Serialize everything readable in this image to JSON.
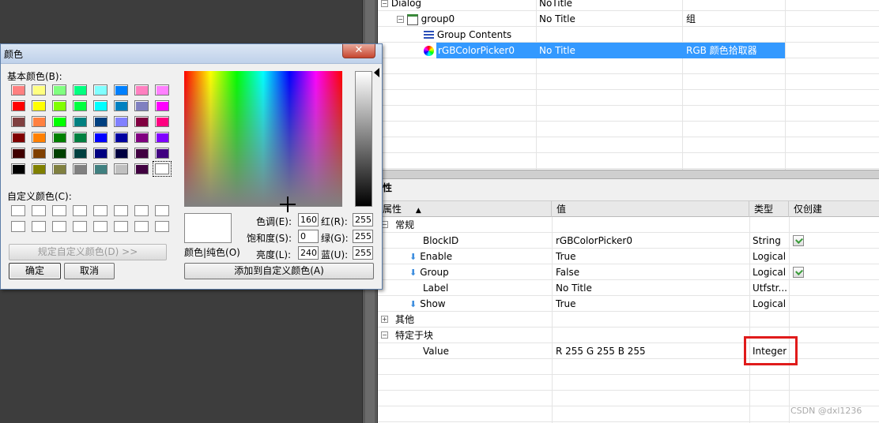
{
  "tree": {
    "rows": [
      {
        "name": "Dialog",
        "title": "NoTitle",
        "desc": ""
      },
      {
        "name": "group0",
        "title": "No Title",
        "desc": "组"
      },
      {
        "name": "Group Contents",
        "title": "",
        "desc": ""
      },
      {
        "name": "rGBColorPicker0",
        "title": "No Title",
        "desc": "RGB 颜色拾取器"
      }
    ]
  },
  "props": {
    "title": "性",
    "headers": {
      "name": "属性",
      "value": "值",
      "type": "类型",
      "readonly": "仅创建"
    },
    "rows": [
      {
        "kind": "group",
        "name": "常规"
      },
      {
        "kind": "prop",
        "name": "BlockID",
        "value": "rGBColorPicker0",
        "type": "String",
        "check": true,
        "arrow": false
      },
      {
        "kind": "prop",
        "name": "Enable",
        "value": "True",
        "type": "Logical",
        "check": false,
        "arrow": true
      },
      {
        "kind": "prop",
        "name": "Group",
        "value": "False",
        "type": "Logical",
        "check": true,
        "arrow": true
      },
      {
        "kind": "prop",
        "name": "Label",
        "value": "No Title",
        "type": "Utfstr...",
        "check": false,
        "arrow": false
      },
      {
        "kind": "prop",
        "name": "Show",
        "value": "True",
        "type": "Logical",
        "check": false,
        "arrow": true
      },
      {
        "kind": "group",
        "name": "其他",
        "collapsed": true
      },
      {
        "kind": "group",
        "name": "特定于块"
      },
      {
        "kind": "prop",
        "name": "Value",
        "value": "R 255 G 255 B 255",
        "type": "Integer",
        "check": false,
        "arrow": false
      }
    ]
  },
  "watermark": "CSDN @dxl1236",
  "dialog": {
    "title": "颜色",
    "close": "✕",
    "basic_label": "基本颜色(B):",
    "custom_label": "自定义颜色(C):",
    "define_custom": "规定自定义颜色(D) >>",
    "ok": "确定",
    "cancel": "取消",
    "color_solid": "颜色|纯色(O)",
    "hue_label": "色调(E):",
    "sat_label": "饱和度(S):",
    "lum_label": "亮度(L):",
    "red_label": "红(R):",
    "green_label": "绿(G):",
    "blue_label": "蓝(U):",
    "hue": "160",
    "sat": "0",
    "lum": "240",
    "red": "255",
    "green": "255",
    "blue": "255",
    "add_custom": "添加到自定义颜色(A)",
    "basic_colors": [
      "#ff8080",
      "#ffff80",
      "#80ff80",
      "#00ff80",
      "#80ffff",
      "#0080ff",
      "#ff80c0",
      "#ff80ff",
      "#ff0000",
      "#ffff00",
      "#80ff00",
      "#00ff40",
      "#00ffff",
      "#0080c0",
      "#8080c0",
      "#ff00ff",
      "#804040",
      "#ff8040",
      "#00ff00",
      "#008080",
      "#004080",
      "#8080ff",
      "#800040",
      "#ff0080",
      "#800000",
      "#ff8000",
      "#008000",
      "#008040",
      "#0000ff",
      "#0000a0",
      "#800080",
      "#8000ff",
      "#400000",
      "#804000",
      "#004000",
      "#004040",
      "#000080",
      "#000040",
      "#400040",
      "#400080",
      "#000000",
      "#808000",
      "#808040",
      "#808080",
      "#408080",
      "#c0c0c0",
      "#400040",
      "#ffffff"
    ]
  }
}
